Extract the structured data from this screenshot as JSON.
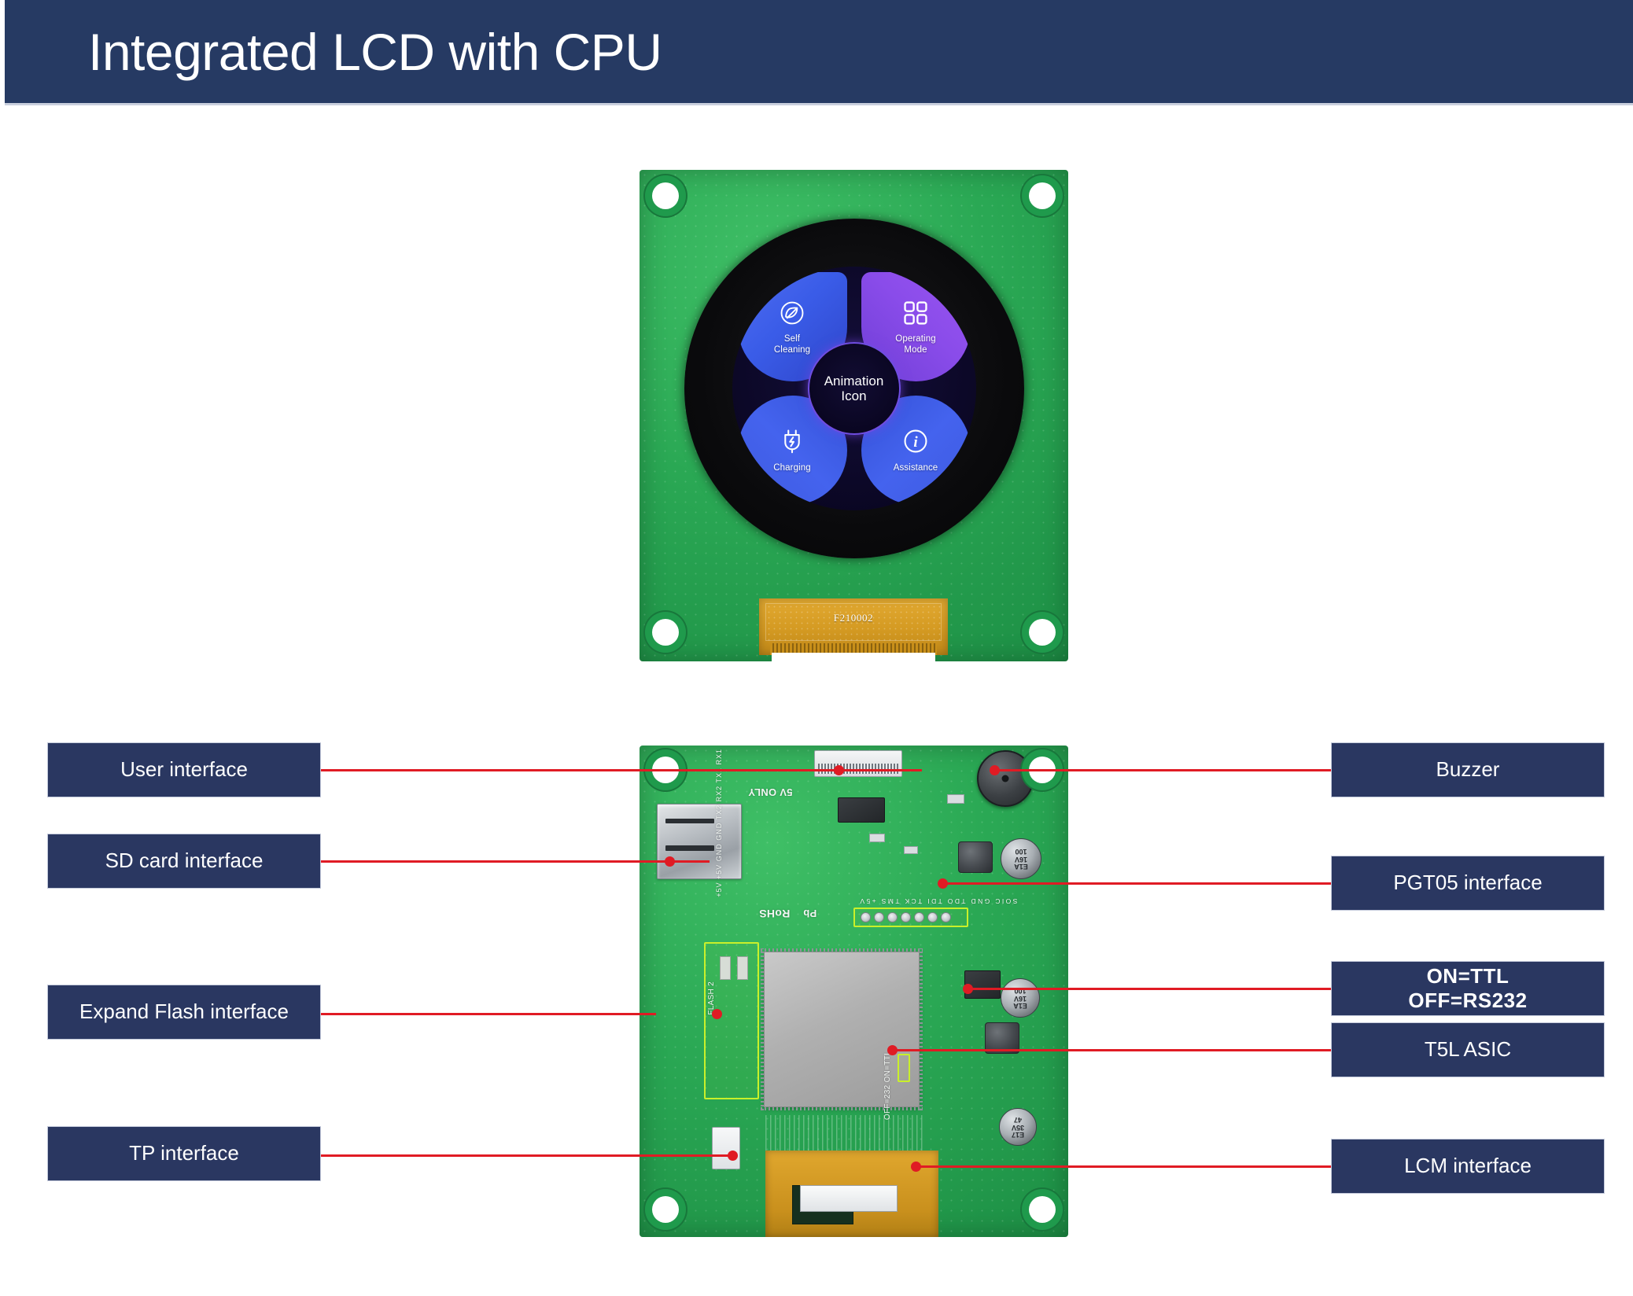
{
  "header": {
    "title": "Integrated LCD with CPU"
  },
  "front_board": {
    "fpc_label": "F210002",
    "screen": {
      "center": {
        "line1": "Animation",
        "line2": "Icon"
      },
      "quadrants": [
        {
          "id": "self-cleaning",
          "icon": "leaf-icon",
          "label_line1": "Self",
          "label_line2": "Cleaning",
          "color": "#3f5ce8"
        },
        {
          "id": "operating-mode",
          "icon": "grid-icon",
          "label_line1": "Operating",
          "label_line2": "Mode",
          "color": "#8a4cea"
        },
        {
          "id": "charging",
          "icon": "plug-bolt-icon",
          "label_line1": "Charging",
          "label_line2": "",
          "color": "#4463ee"
        },
        {
          "id": "assistance",
          "icon": "info-icon",
          "label_line1": "Assistance",
          "label_line2": "",
          "color": "#4463ee"
        }
      ]
    }
  },
  "back_board": {
    "silkscreen": {
      "rohs": "RoHS",
      "pb": "Pb",
      "five_volt_only": "5V ONLY",
      "ttl_switch": "OFF=232  ON=TTL",
      "flash": "FLASH 2",
      "uart_pins": "+5V +5V GND GND TX2 RX2 TX1 RX1",
      "jtag_pins": "SOIC GND TDO TDI TCK TMS +5V"
    },
    "capacitors": [
      {
        "value_line1": "100",
        "value_line2": "16V",
        "value_line3": "E1A"
      },
      {
        "value_line1": "100",
        "value_line2": "16V",
        "value_line3": "E1A"
      },
      {
        "value_line1": "47",
        "value_line2": "35V",
        "value_line3": "E17"
      }
    ]
  },
  "callouts": {
    "left": [
      {
        "id": "user-interface",
        "label": "User interface"
      },
      {
        "id": "sd-card-interface",
        "label": "SD card interface"
      },
      {
        "id": "expand-flash-interface",
        "label": "Expand Flash interface"
      },
      {
        "id": "tp-interface",
        "label": "TP interface"
      }
    ],
    "right": [
      {
        "id": "buzzer",
        "label": "Buzzer"
      },
      {
        "id": "pgt05-interface",
        "label": "PGT05 interface"
      },
      {
        "id": "ttl-rs232",
        "label_line1": "ON=TTL",
        "label_line2": "OFF=RS232"
      },
      {
        "id": "t5l-asic",
        "label": "T5L ASIC"
      },
      {
        "id": "lcm-interface",
        "label": "LCM interface"
      }
    ]
  },
  "colors": {
    "header_bg": "#263a63",
    "callout_bg": "#2a3761",
    "leader_red": "#e01b24",
    "pcb_green": "#2aa854"
  }
}
